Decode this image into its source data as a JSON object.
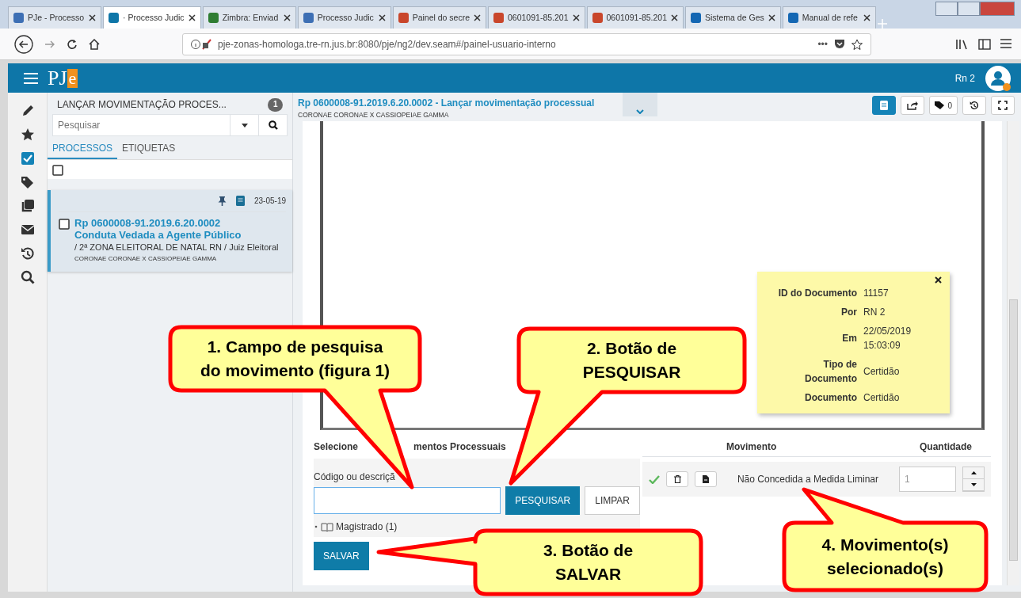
{
  "browser": {
    "tabs": [
      {
        "title": "PJe - Processo",
        "selected": false
      },
      {
        "title": "· Processo Judic",
        "selected": true
      },
      {
        "title": "Zimbra: Enviad",
        "selected": false
      },
      {
        "title": "Processo Judic",
        "selected": false
      },
      {
        "title": "Painel do secre",
        "selected": false
      },
      {
        "title": "0601091-85.201",
        "selected": false
      },
      {
        "title": "0601091-85.201",
        "selected": false
      },
      {
        "title": "Sistema de Ges",
        "selected": false
      },
      {
        "title": "Manual de refe",
        "selected": false
      }
    ],
    "url": "pje-zonas-homologa.tre-rn.jus.br:8080/pje/ng2/dev.seam#/painel-usuario-interno",
    "page_actions": "•••"
  },
  "app": {
    "logo_main": "PJ",
    "logo_accent": "e",
    "user": "Rn 2"
  },
  "rail": [
    {
      "kind": "pencil"
    },
    {
      "kind": "star"
    },
    {
      "kind": "check"
    },
    {
      "kind": "tags"
    },
    {
      "kind": "copy"
    },
    {
      "kind": "mail"
    },
    {
      "kind": "history"
    },
    {
      "kind": "search"
    }
  ],
  "left_panel": {
    "title": "LANÇAR MOVIMENTAÇÃO PROCES...",
    "badge": "1",
    "search": {
      "placeholder": "Pesquisar"
    },
    "tabs": [
      {
        "label": "PROCESSOS",
        "selected": true
      },
      {
        "label": "ETIQUETAS",
        "selected": false
      }
    ],
    "select_all": {
      "checked": false
    },
    "processes": [
      {
        "date": "23-05-19",
        "number": "Rp 0600008-91.2019.6.20.0002",
        "class": "Conduta Vedada a Agente Público",
        "location": "/ 2ª ZONA ELEITORAL DE NATAL RN / Juiz Eleitoral",
        "parties": "CORONAE CORONAE X CASSIOPEIAE GAMMA",
        "checked": false,
        "selected": true
      }
    ]
  },
  "main": {
    "title": "Rp 0600008-91.2019.6.20.0002 - Lançar movimentação processual",
    "subtitle": "CORONAE CORONAE X CASSIOPEIAE GAMMA",
    "tag_count": "0",
    "document_info": {
      "rows": [
        {
          "label": [
            "ID do Documento"
          ],
          "value": [
            "11157"
          ]
        },
        {
          "label": [
            "Por"
          ],
          "value": [
            "RN 2"
          ]
        },
        {
          "label": [
            "Em"
          ],
          "value": [
            "22/05/2019",
            "15:03:09"
          ]
        },
        {
          "label": [
            "Tipo de",
            "Documento"
          ],
          "value": [
            "Certidão"
          ]
        },
        {
          "label": [
            "Documento"
          ],
          "value": [
            "Certidão"
          ]
        }
      ]
    },
    "form": {
      "heading_start": "Selecione",
      "heading_end": "mentos Processuais",
      "field_label": "Código ou descriçã",
      "search_button": "PESQUISAR",
      "clear_button": "LIMPAR",
      "tree": [
        {
          "label": "Magistrado (1)",
          "expanded": false
        }
      ],
      "save_button": "SALVAR"
    },
    "selected_table": {
      "columns": [
        "Movimento",
        "Quantidade"
      ],
      "rows": [
        {
          "movimento": "Não Concedida a Medida Liminar",
          "quantidade": "1"
        }
      ]
    }
  },
  "callouts": [
    {
      "lines": [
        "1. Campo de pesquisa",
        "do movimento (figura 1)"
      ]
    },
    {
      "lines": [
        "2. Botão de",
        "PESQUISAR"
      ]
    },
    {
      "lines": [
        "3. Botão de",
        "SALVAR"
      ]
    },
    {
      "lines": [
        "4. Movimento(s)",
        "selecionado(s)"
      ]
    }
  ]
}
